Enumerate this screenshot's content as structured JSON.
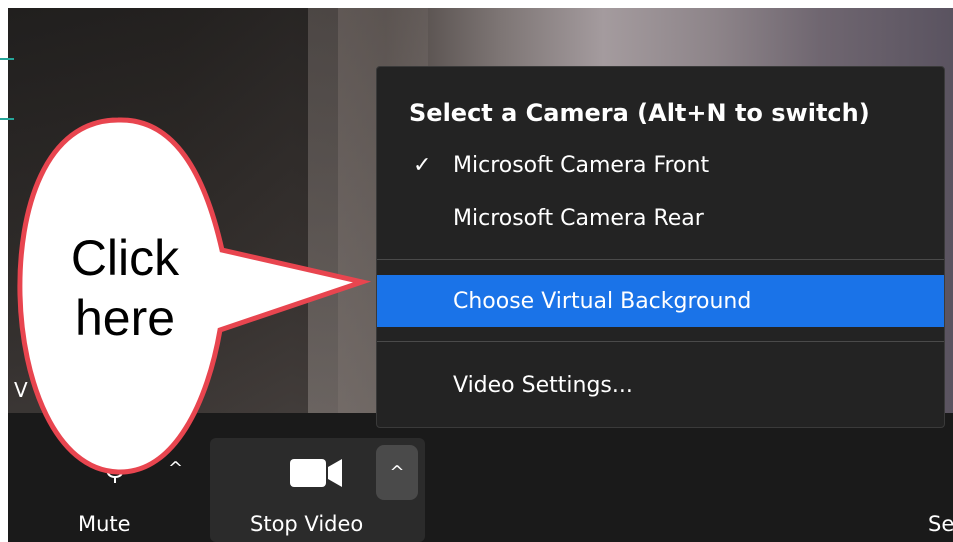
{
  "video": {
    "label": "V"
  },
  "menu": {
    "header": "Select a Camera (Alt+N to switch)",
    "items": [
      {
        "label": "Microsoft Camera Front",
        "checked": true
      },
      {
        "label": "Microsoft Camera Rear",
        "checked": false
      },
      {
        "label": "Choose Virtual Background",
        "highlighted": true
      },
      {
        "label": "Video Settings..."
      }
    ],
    "check_glyph": "✓"
  },
  "toolbar": {
    "mute_label": "Mute",
    "stop_video_label": "Stop Video",
    "partial_label": "Se",
    "caret_glyph": "^"
  },
  "callout": {
    "line1": "Click",
    "line2": "here"
  },
  "colors": {
    "highlight": "#1a73e8",
    "menu_bg": "#232323",
    "callout_border": "#e8454f",
    "toolbar_bg": "#1a1a1a"
  }
}
